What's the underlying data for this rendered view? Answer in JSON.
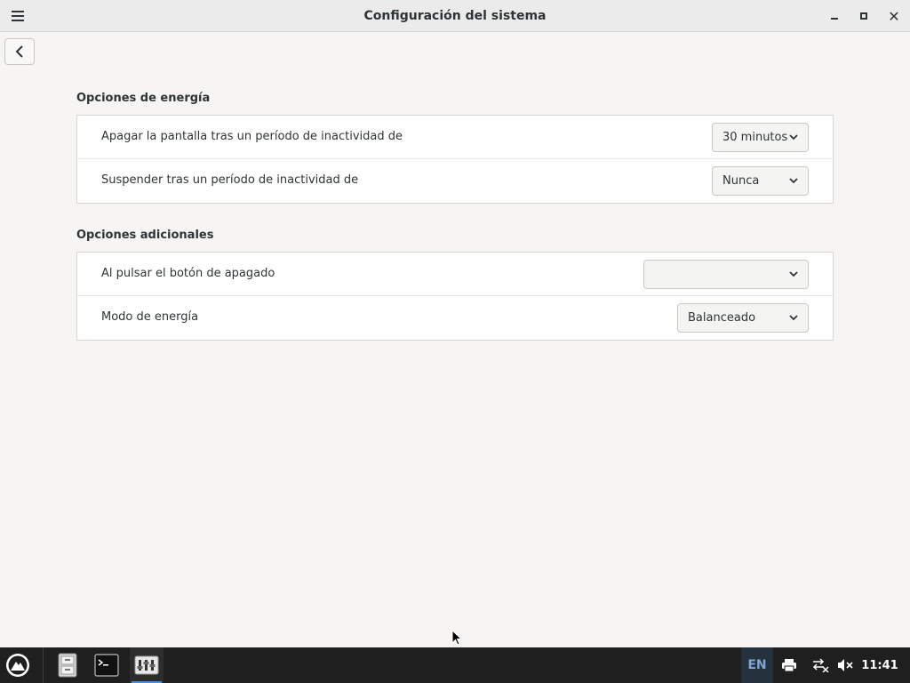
{
  "window": {
    "title": "Configuración del sistema",
    "menu_icon": "hamburger-icon",
    "minimize_icon": "minimize-icon",
    "maximize_icon": "maximize-icon",
    "close_icon": "close-icon",
    "close_glyph": "✕"
  },
  "nav": {
    "back_icon": "chevron-left-icon"
  },
  "power": {
    "title": "Opciones de energía",
    "rows": [
      {
        "label": "Apagar la pantalla tras un período de inactividad de",
        "value": "30 minutos"
      },
      {
        "label": "Suspender tras un período de inactividad de",
        "value": "Nunca"
      }
    ]
  },
  "additional": {
    "title": "Opciones adicionales",
    "rows": [
      {
        "label": "Al pulsar el botón de apagado",
        "value": ""
      },
      {
        "label": "Modo de energía",
        "value": "Balanceado"
      }
    ]
  },
  "taskbar": {
    "start_icon": "distro-logo-icon",
    "apps": [
      "file-cabinet-icon",
      "terminal-icon",
      "settings-app-icon"
    ],
    "keyboard_layout": "EN",
    "tray_icons": [
      "printer-icon",
      "network-disconnected-icon",
      "volume-muted-icon"
    ],
    "clock": "11:41"
  },
  "colors": {
    "taskbar_bg": "#1f1f1f",
    "window_bg": "#f6f5f4",
    "active_indicator": "#4a90d9"
  }
}
